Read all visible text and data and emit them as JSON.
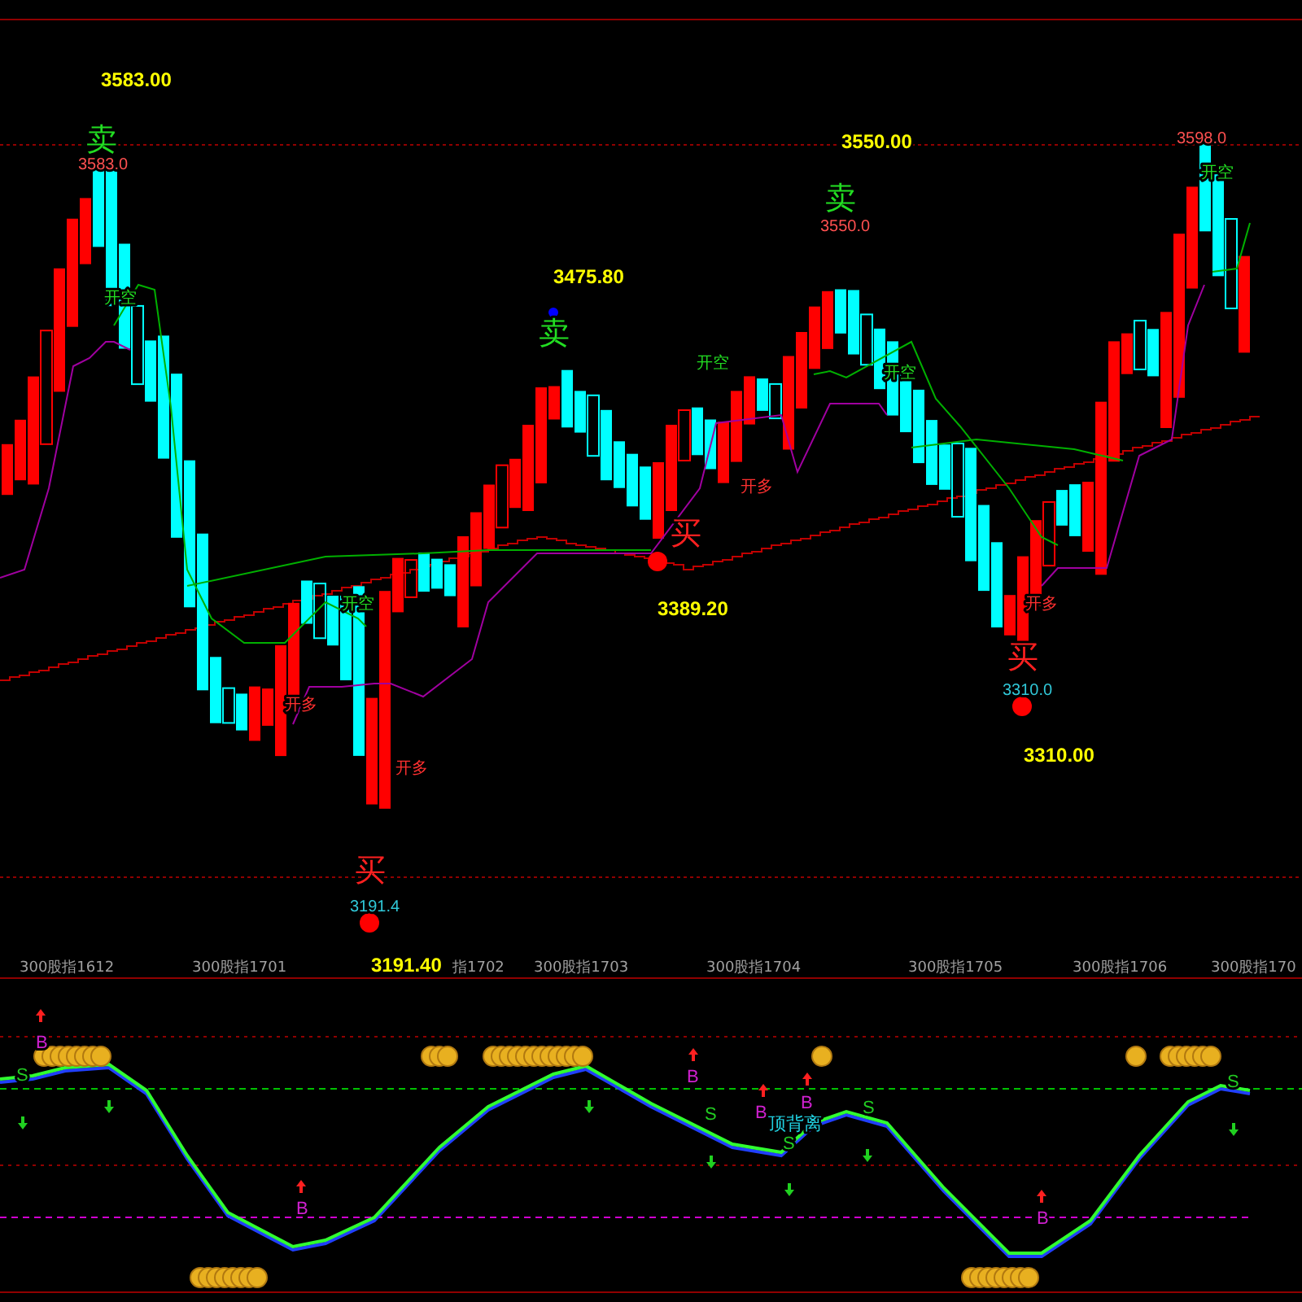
{
  "price_chart": {
    "annotations": [
      {
        "kind": "level",
        "text": "3583.00"
      },
      {
        "kind": "sell",
        "text": "卖"
      },
      {
        "kind": "peak",
        "text": "3583.0"
      },
      {
        "kind": "short",
        "text": "开空"
      },
      {
        "kind": "level",
        "text": "3475.80"
      },
      {
        "kind": "sell",
        "text": "卖"
      },
      {
        "kind": "level",
        "text": "3550.00"
      },
      {
        "kind": "sell",
        "text": "卖"
      },
      {
        "kind": "peak",
        "text": "3550.0"
      },
      {
        "kind": "peak",
        "text": "3598.0"
      },
      {
        "kind": "short",
        "text": "开空"
      },
      {
        "kind": "short",
        "text": "开空"
      },
      {
        "kind": "short",
        "text": "开空"
      },
      {
        "kind": "short",
        "text": "开空"
      },
      {
        "kind": "long",
        "text": "开多"
      },
      {
        "kind": "long",
        "text": "开多"
      },
      {
        "kind": "long",
        "text": "开多"
      },
      {
        "kind": "long",
        "text": "开多"
      },
      {
        "kind": "buy",
        "text": "买"
      },
      {
        "kind": "trough",
        "text": "3191.4"
      },
      {
        "kind": "buy",
        "text": "买"
      },
      {
        "kind": "level",
        "text": "3389.20"
      },
      {
        "kind": "buy",
        "text": "买"
      },
      {
        "kind": "trough",
        "text": "3310.0"
      },
      {
        "kind": "level",
        "text": "3310.00"
      },
      {
        "kind": "level",
        "text": "3191.40"
      }
    ]
  },
  "time_axis": {
    "labels": [
      "300股指1612",
      "300股指1701",
      "指1702",
      "300股指1703",
      "300股指1704",
      "300股指1705",
      "300股指1706",
      "300股指170"
    ]
  },
  "indicator": {
    "markers": [
      {
        "kind": "buy",
        "text": "B"
      },
      {
        "kind": "buy",
        "text": "B"
      },
      {
        "kind": "buy",
        "text": "B"
      },
      {
        "kind": "buy",
        "text": "B"
      },
      {
        "kind": "buy",
        "text": "B"
      },
      {
        "kind": "buy",
        "text": "B"
      },
      {
        "kind": "sell",
        "text": "S"
      },
      {
        "kind": "sell",
        "text": "S"
      },
      {
        "kind": "sell",
        "text": "S"
      },
      {
        "kind": "sell",
        "text": "S"
      },
      {
        "kind": "sell",
        "text": "S"
      },
      {
        "kind": "divergence",
        "text": "顶背离"
      }
    ]
  }
}
